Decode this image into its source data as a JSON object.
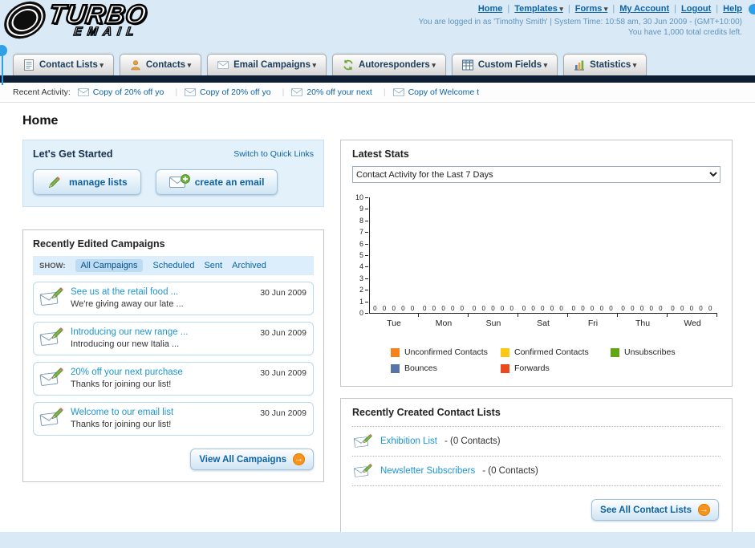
{
  "header": {
    "logo_line1": "TURBO",
    "logo_line2": "EMAIL",
    "nav": [
      "Home",
      "Templates",
      "Forms",
      "My Account",
      "Logout",
      "Help"
    ],
    "login_info": "You are logged in as 'Timothy Smith' | System Time: 10:58 am, 30 Jun 2009 - (GMT+10:00)",
    "credits_info": "You have 1,000 total credits left."
  },
  "tabs": [
    "Contact Lists",
    "Contacts",
    "Email Campaigns",
    "Autoresponders",
    "Custom Fields",
    "Statistics"
  ],
  "recent_activity": {
    "label": "Recent Activity:",
    "items": [
      "Copy of 20% off yo",
      "Copy of 20% off yo",
      "20% off your next",
      "Copy of Welcome t"
    ]
  },
  "page_title": "Home",
  "get_started": {
    "title": "Let's Get Started",
    "switch_link": "Switch to Quick Links",
    "manage_lists_label": "manage lists",
    "create_email_label": "create an email"
  },
  "campaigns": {
    "title": "Recently Edited Campaigns",
    "show_label": "SHOW:",
    "filters": [
      "All Campaigns",
      "Scheduled",
      "Sent",
      "Archived"
    ],
    "active_filter": "All Campaigns",
    "items": [
      {
        "title": "See us at the retail food ...",
        "subtitle": "We're giving away our late ...",
        "date": "30 Jun 2009"
      },
      {
        "title": "Introducing our new range ...",
        "subtitle": "Introducing our new Italia ...",
        "date": "30 Jun 2009"
      },
      {
        "title": "20% off your next purchase",
        "subtitle": "Thanks for joining our list!",
        "date": "30 Jun 2009"
      },
      {
        "title": "Welcome to our email list",
        "subtitle": "Thanks for joining our list!",
        "date": "30 Jun 2009"
      }
    ],
    "view_all_label": "View All Campaigns"
  },
  "latest_stats": {
    "title": "Latest Stats",
    "dropdown_value": "Contact Activity for the Last 7 Days",
    "chart_data": {
      "type": "bar",
      "categories": [
        "Tue",
        "Mon",
        "Sun",
        "Sat",
        "Fri",
        "Thu",
        "Wed"
      ],
      "series": [
        {
          "name": "Unconfirmed Contacts",
          "color": "#f5821f",
          "values": [
            0,
            0,
            0,
            0,
            0,
            0,
            0
          ]
        },
        {
          "name": "Confirmed Contacts",
          "color": "#fdc713",
          "values": [
            0,
            0,
            0,
            0,
            0,
            0,
            0
          ]
        },
        {
          "name": "Unsubscribes",
          "color": "#63a613",
          "values": [
            0,
            0,
            0,
            0,
            0,
            0,
            0
          ]
        },
        {
          "name": "Bounces",
          "color": "#5674a8",
          "values": [
            0,
            0,
            0,
            0,
            0,
            0,
            0
          ]
        },
        {
          "name": "Forwards",
          "color": "#e8491d",
          "values": [
            0,
            0,
            0,
            0,
            0,
            0,
            0
          ]
        }
      ],
      "ylim": [
        0,
        10
      ],
      "grid": false,
      "legend_position": "bottom"
    }
  },
  "contact_lists": {
    "title": "Recently Created Contact Lists",
    "items": [
      {
        "name": "Exhibition List",
        "suffix": "- (0 Contacts)"
      },
      {
        "name": "Newsletter Subscribers",
        "suffix": "- (0 Contacts)"
      }
    ],
    "see_all_label": "See All Contact Lists"
  },
  "colors": {
    "header_bg": "#d9eaf6",
    "dark_bar": "#0d1d33",
    "link_blue": "#0d63a5",
    "campaign_link_blue": "#1b96d2",
    "accent_orange": "#f7941d"
  }
}
